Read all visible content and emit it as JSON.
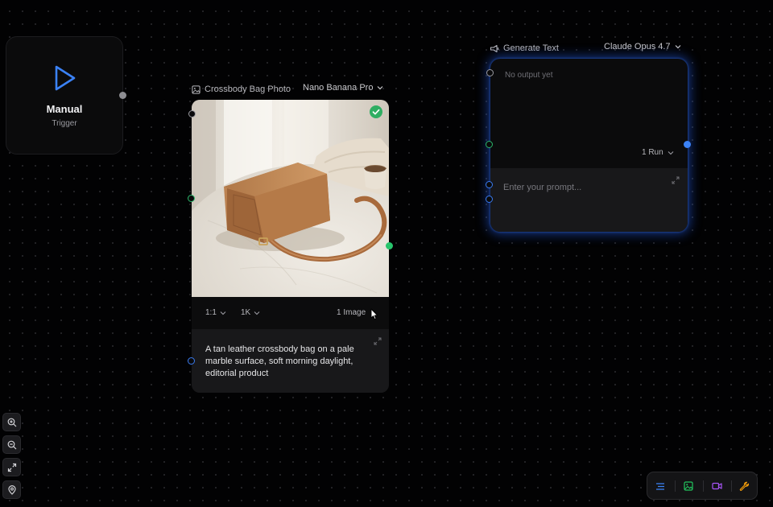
{
  "trigger_node": {
    "title": "Manual",
    "subtitle": "Trigger",
    "icon": "play-icon",
    "accent": "#3b82f6"
  },
  "image_node": {
    "title": "Crossbody Bag Photo",
    "icon": "image-icon",
    "model": "Nano Banana Pro",
    "status": "check-icon",
    "aspect_ratio": "1:1",
    "resolution": "1K",
    "count_label": "1 Image",
    "prompt": "A tan leather crossbody bag on a pale marble surface, soft morning daylight, editorial product",
    "status_color": "#2fae62"
  },
  "text_node": {
    "title": "Generate Text",
    "icon": "text-generate-icon",
    "model": "Claude Opus 4.7",
    "output": "No output yet",
    "run_label": "1 Run",
    "prompt_placeholder": "Enter your prompt...",
    "glow_color": "#245ce6"
  },
  "zoom_controls": [
    {
      "name": "zoom-in",
      "icon": "zoom-in-icon"
    },
    {
      "name": "zoom-out",
      "icon": "zoom-out-icon"
    },
    {
      "name": "fit-view",
      "icon": "expand-icon"
    },
    {
      "name": "locate",
      "icon": "location-pin-icon"
    }
  ],
  "toolbar": [
    {
      "name": "text-node",
      "icon": "text-lines-icon",
      "color": "#3b82f6"
    },
    {
      "name": "image-node",
      "icon": "image-icon",
      "color": "#22c55e"
    },
    {
      "name": "video-node",
      "icon": "video-camera-icon",
      "color": "#a855f7"
    },
    {
      "name": "tools",
      "icon": "wrench-icon",
      "color": "#f59e0b"
    }
  ]
}
